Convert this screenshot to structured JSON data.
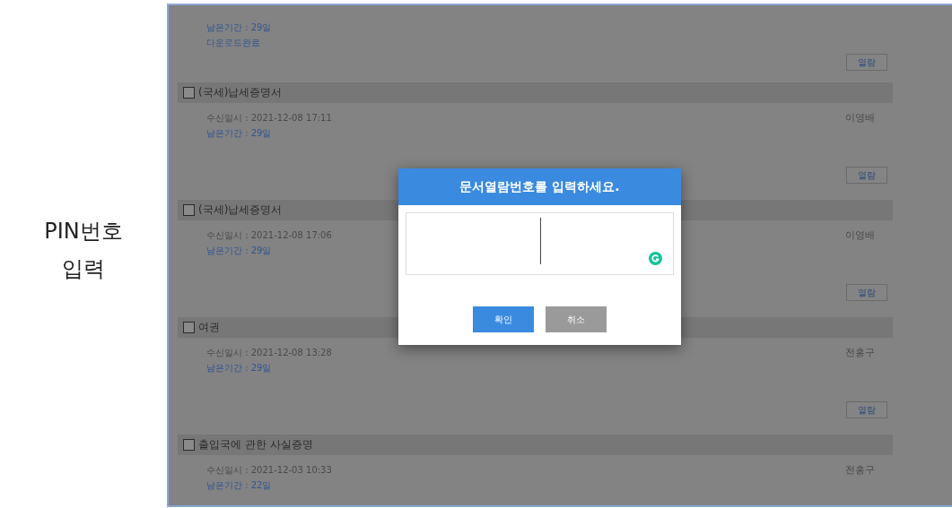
{
  "side_label": {
    "line_1": "PIN번호",
    "line_2": "입력"
  },
  "top_item": {
    "remaining": "남은기간 : 29일",
    "status": "다운로드완료",
    "open_button": "열람"
  },
  "items": [
    {
      "title": "(국세)납세증명서",
      "checked": false,
      "received": "수신일시 : 2021-12-08 17:11",
      "remaining": "남은기간 : 29일",
      "sender": "이영배",
      "open_button": "열람"
    },
    {
      "title": "(국세)납세증명서",
      "checked": false,
      "received": "수신일시 : 2021-12-08 17:06",
      "remaining": "남은기간 : 29일",
      "sender": "이영배",
      "open_button": "열람"
    },
    {
      "title": "여권",
      "checked": false,
      "received": "수신일시 : 2021-12-08 13:28",
      "remaining": "남은기간 : 29일",
      "sender": "전홍구",
      "open_button": "열람"
    },
    {
      "title": "출입국에 관한 사실증명",
      "checked": false,
      "received": "수신일시 : 2021-12-03 10:33",
      "remaining": "남은기간 : 22일",
      "sender": "전홍구"
    }
  ],
  "modal": {
    "title": "문서열람번호를 입력하세요.",
    "confirm": "확인",
    "cancel": "취소"
  }
}
